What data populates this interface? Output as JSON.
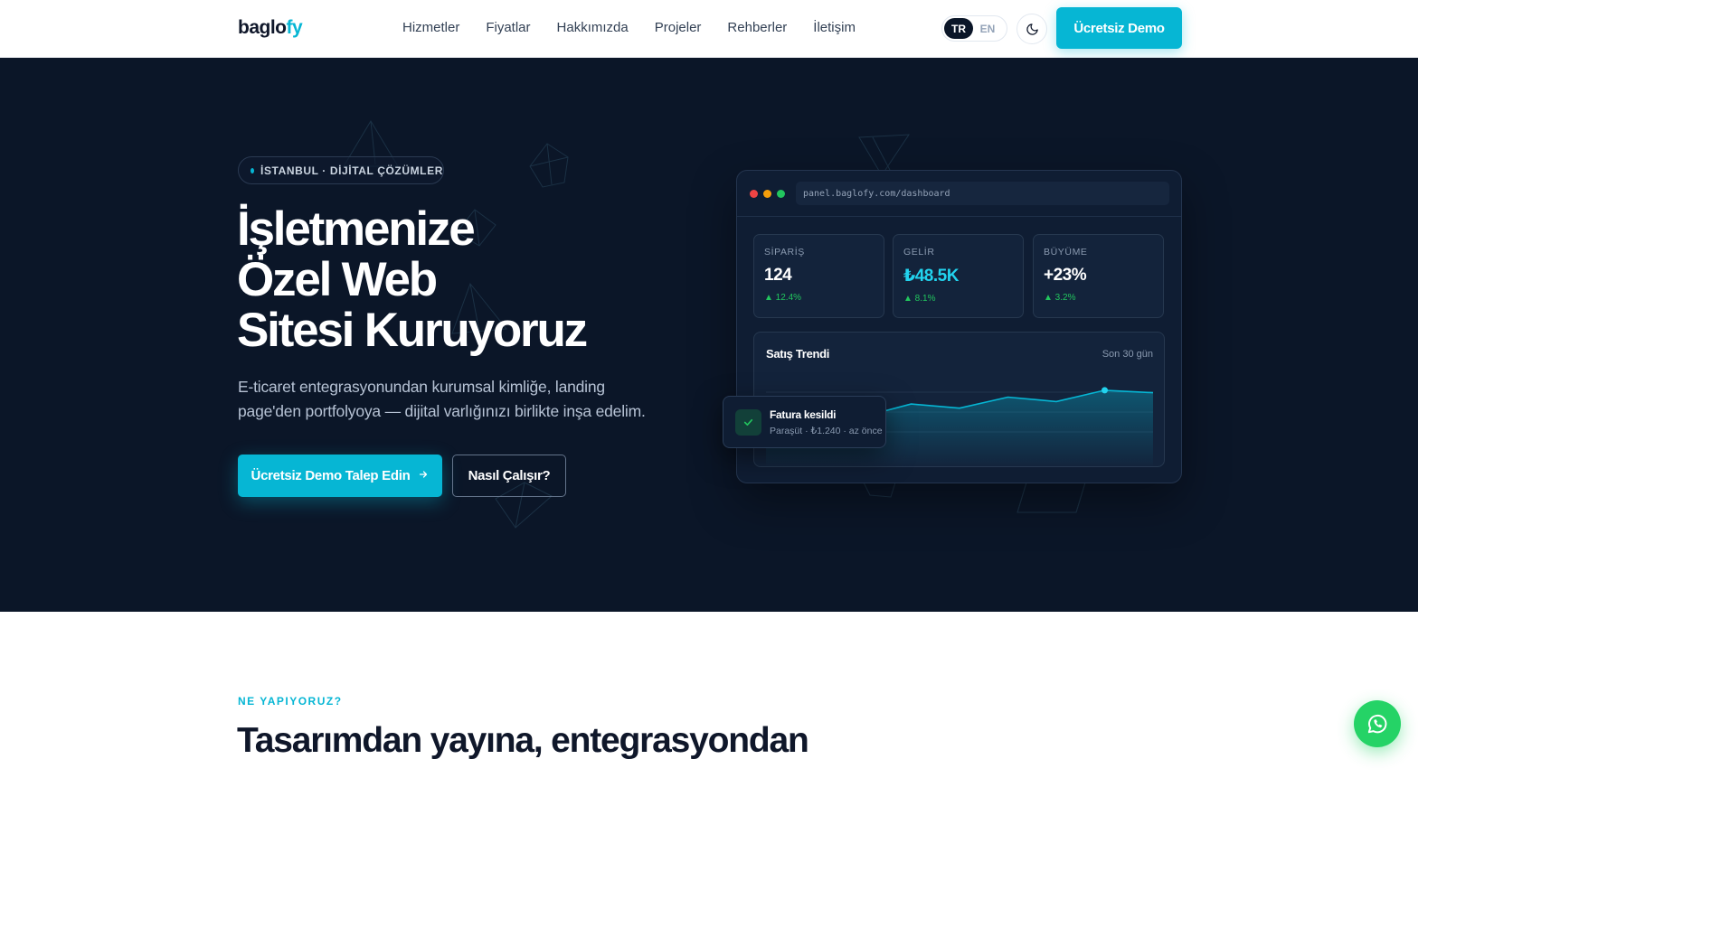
{
  "nav": {
    "logo_main": "baglo",
    "logo_accent": "fy",
    "links": [
      "Hizmetler",
      "Fiyatlar",
      "Hakkımızda",
      "Projeler",
      "Rehberler",
      "İletişim"
    ],
    "lang_tr": "TR",
    "lang_en": "EN",
    "lang_active": "TR",
    "theme_icon": "moon-icon",
    "demo_button": "Ücretsiz Demo"
  },
  "hero": {
    "badge": "İSTANBUL · DİJİTAL ÇÖZÜMLER",
    "title_line1": "İşletmenize",
    "title_line2": "Özel Web",
    "title_line3": "Sitesi Kuruyoruz",
    "subtitle": "E-ticaret entegrasyonundan kurumsal kimliğe, landing page'den portfolyoya — dijital varlığınızı birlikte inşa edelim.",
    "cta_primary": "Ücretsiz Demo Talep Edin",
    "cta_primary_icon": "arrow-right-icon",
    "cta_secondary": "Nasıl Çalışır?"
  },
  "dashboard": {
    "url": "panel.baglofy.com/dashboard",
    "stats": [
      {
        "label": "SİPARİŞ",
        "value": "124",
        "delta": "▲ 12.4%"
      },
      {
        "label": "GELİR",
        "value": "₺48.5K",
        "delta": "▲ 8.1%"
      },
      {
        "label": "BÜYÜME",
        "value": "+23%",
        "delta": "▲ 3.2%"
      }
    ],
    "chart_title": "Satış Trendi",
    "chart_range": "Son 30 gün",
    "trend_relative": [
      0.18,
      0.28,
      0.18,
      0.55,
      0.43,
      0.75,
      0.62,
      0.95,
      0.88
    ]
  },
  "toast": {
    "title": "Fatura kesildi",
    "subtitle": "Paraşüt · ₺1.240 · az önce",
    "icon": "check-icon"
  },
  "section": {
    "eyebrow": "NE YAPIYORUZ?",
    "title": "Tasarımdan yayına, entegrasyondan"
  },
  "colors": {
    "accent": "#06b6d4",
    "hero_bg": "#0b1628",
    "success": "#22c55e",
    "whatsapp": "#25d366"
  },
  "whatsapp_icon": "whatsapp-icon"
}
